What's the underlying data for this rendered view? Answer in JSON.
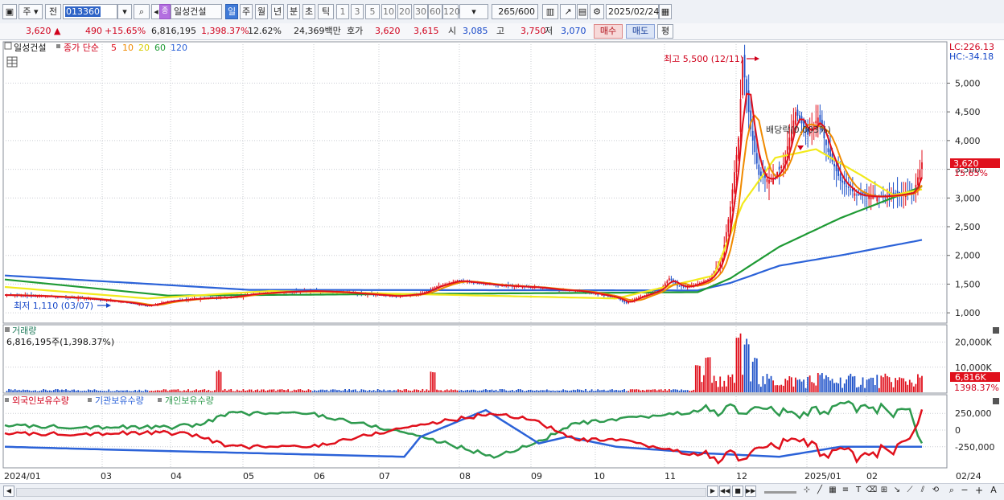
{
  "toolbar": {
    "market_select": "주",
    "prev_label": "전",
    "code": "013360",
    "stock_name": "일성건설",
    "stock_badge": "종",
    "periods": [
      "일",
      "주",
      "월",
      "년",
      "분",
      "초",
      "틱"
    ],
    "selected_period": "일",
    "intervals": [
      "1",
      "3",
      "5",
      "10",
      "20",
      "30",
      "60",
      "120"
    ],
    "count_display": "265",
    "count_total": "/600",
    "date": "2025/02/24"
  },
  "quote": {
    "price": "3,620",
    "change_arrow": "▲",
    "change": "490",
    "change_pct": "+15.65%",
    "volume": "6,816,195",
    "volume_ratio": "1,398.37%",
    "turnover_pct": "12.62%",
    "amount": "24,369백만",
    "bid_label": "호가",
    "ask": "3,620",
    "bid": "3,615",
    "open_label": "시",
    "open": "3,085",
    "high_label": "고",
    "high": "3,750",
    "low_label": "저",
    "low": "3,070",
    "buy_label": "매수",
    "sell_label": "매도",
    "eval_label": "평"
  },
  "price_panel": {
    "stock_label": "일성건설",
    "legend_prefix": "종가 단순",
    "ma_periods": [
      "5",
      "10",
      "20",
      "60",
      "120"
    ],
    "lc": "LC:226.13",
    "hc": "HC:-34.18",
    "max_label": "최고 5,500 (12/11)",
    "min_label": "최저 1,110 (03/07)",
    "event_label": "배당락(0.003%)",
    "last_price": "3,620",
    "last_pct": "15.65%",
    "y_ticks": [
      "1,000",
      "1,500",
      "2,000",
      "2,500",
      "3,000",
      "3,500",
      "4,000",
      "4,500",
      "5,000"
    ]
  },
  "volume_panel": {
    "title": "거래량",
    "value": "6,816,195주(1,398.37%)",
    "y_ticks": [
      "10,000K",
      "20,000K"
    ],
    "last_value": "6,816K",
    "last_pct": "1398.37%"
  },
  "holdings_panel": {
    "series": [
      "외국인보유수량",
      "기관보유수량",
      "개인보유수량"
    ],
    "y_ticks": [
      "250,000",
      "0",
      "-250,000"
    ]
  },
  "x_labels": [
    "2024/01",
    "03",
    "04",
    "05",
    "06",
    "07",
    "08",
    "09",
    "10",
    "11",
    "12",
    "2025/01",
    "02",
    "02/24"
  ],
  "colors": {
    "up": "#e0101c",
    "down": "#1c50c8",
    "ma5": "#e0101c",
    "ma10": "#f08a00",
    "ma20": "#f2ea1c",
    "ma60": "#1e9a34",
    "ma120": "#2b62d8",
    "foreign": "#e0101c",
    "institution": "#2b62d8",
    "individual": "#2e9a4e"
  },
  "chart_data": {
    "type": "candlestick",
    "x_range": [
      "2024/01",
      "2025/02/24"
    ],
    "price_ylim": [
      1000,
      5500
    ],
    "price_path": [
      [
        0,
        1310
      ],
      [
        20,
        1290
      ],
      [
        40,
        1250
      ],
      [
        60,
        1180
      ],
      [
        70,
        1120
      ],
      [
        80,
        1200
      ],
      [
        95,
        1250
      ],
      [
        110,
        1270
      ],
      [
        122,
        1330
      ],
      [
        135,
        1360
      ],
      [
        150,
        1380
      ],
      [
        165,
        1360
      ],
      [
        180,
        1320
      ],
      [
        192,
        1290
      ],
      [
        204,
        1330
      ],
      [
        212,
        1460
      ],
      [
        222,
        1560
      ],
      [
        232,
        1520
      ],
      [
        242,
        1480
      ],
      [
        252,
        1460
      ],
      [
        262,
        1440
      ],
      [
        272,
        1400
      ],
      [
        282,
        1380
      ],
      [
        292,
        1320
      ],
      [
        300,
        1260
      ],
      [
        305,
        1170
      ],
      [
        310,
        1260
      ],
      [
        316,
        1330
      ],
      [
        322,
        1420
      ],
      [
        326,
        1600
      ],
      [
        330,
        1470
      ],
      [
        335,
        1450
      ],
      [
        341,
        1520
      ],
      [
        346,
        1600
      ],
      [
        352,
        1960
      ],
      [
        356,
        2850
      ],
      [
        360,
        4050
      ],
      [
        362,
        5400
      ],
      [
        366,
        4200
      ],
      [
        370,
        3400
      ],
      [
        376,
        3300
      ],
      [
        382,
        3600
      ],
      [
        388,
        4500
      ],
      [
        394,
        4100
      ],
      [
        399,
        4400
      ],
      [
        404,
        3800
      ],
      [
        410,
        3300
      ],
      [
        418,
        3050
      ],
      [
        428,
        3020
      ],
      [
        438,
        3050
      ],
      [
        446,
        3100
      ],
      [
        450,
        3620
      ]
    ],
    "ma120_path": [
      [
        0,
        1650
      ],
      [
        120,
        1400
      ],
      [
        340,
        1390
      ],
      [
        356,
        1520
      ],
      [
        380,
        1820
      ],
      [
        410,
        2000
      ],
      [
        450,
        2270
      ]
    ],
    "ma60_path": [
      [
        0,
        1580
      ],
      [
        80,
        1300
      ],
      [
        340,
        1360
      ],
      [
        356,
        1600
      ],
      [
        380,
        2150
      ],
      [
        410,
        2650
      ],
      [
        450,
        3200
      ]
    ],
    "ma20_path": [
      [
        0,
        1450
      ],
      [
        70,
        1250
      ],
      [
        130,
        1380
      ],
      [
        300,
        1250
      ],
      [
        348,
        1650
      ],
      [
        362,
        2900
      ],
      [
        378,
        3700
      ],
      [
        398,
        3850
      ],
      [
        420,
        3400
      ],
      [
        436,
        3050
      ],
      [
        450,
        3150
      ]
    ],
    "volume_spikes": [
      [
        105,
        9000
      ],
      [
        210,
        9000
      ],
      [
        340,
        11000
      ],
      [
        345,
        15000
      ],
      [
        360,
        24000
      ],
      [
        364,
        22000
      ],
      [
        368,
        14000
      ],
      [
        400,
        8000
      ],
      [
        450,
        6816
      ]
    ],
    "volume_ylim": [
      0,
      25000
    ],
    "foreign_path": [
      [
        0,
        -60000
      ],
      [
        80,
        -40000
      ],
      [
        95,
        -80000
      ],
      [
        110,
        -250000
      ],
      [
        150,
        -250000
      ],
      [
        200,
        60000
      ],
      [
        240,
        250000
      ],
      [
        260,
        150000
      ],
      [
        280,
        -150000
      ],
      [
        300,
        -150000
      ],
      [
        345,
        -400000
      ],
      [
        360,
        -400000
      ],
      [
        376,
        -250000
      ],
      [
        390,
        -150000
      ],
      [
        400,
        -300000
      ],
      [
        420,
        -400000
      ],
      [
        444,
        -200000
      ],
      [
        450,
        250000
      ]
    ],
    "individual_path": [
      [
        0,
        60000
      ],
      [
        80,
        40000
      ],
      [
        95,
        80000
      ],
      [
        110,
        250000
      ],
      [
        150,
        250000
      ],
      [
        200,
        -60000
      ],
      [
        240,
        -400000
      ],
      [
        260,
        -200000
      ],
      [
        280,
        100000
      ],
      [
        300,
        150000
      ],
      [
        345,
        300000
      ],
      [
        360,
        300000
      ],
      [
        376,
        300000
      ],
      [
        390,
        200000
      ],
      [
        400,
        320000
      ],
      [
        420,
        350000
      ],
      [
        444,
        250000
      ],
      [
        450,
        -250000
      ]
    ],
    "institution_path": [
      [
        0,
        -250000
      ],
      [
        60,
        -300000
      ],
      [
        196,
        -400000
      ],
      [
        204,
        -100000
      ],
      [
        236,
        300000
      ],
      [
        262,
        -200000
      ],
      [
        276,
        -100000
      ],
      [
        300,
        -250000
      ],
      [
        345,
        -350000
      ],
      [
        380,
        -400000
      ],
      [
        410,
        -250000
      ],
      [
        450,
        -250000
      ]
    ],
    "holdings_ylim": [
      -450000,
      400000
    ]
  }
}
